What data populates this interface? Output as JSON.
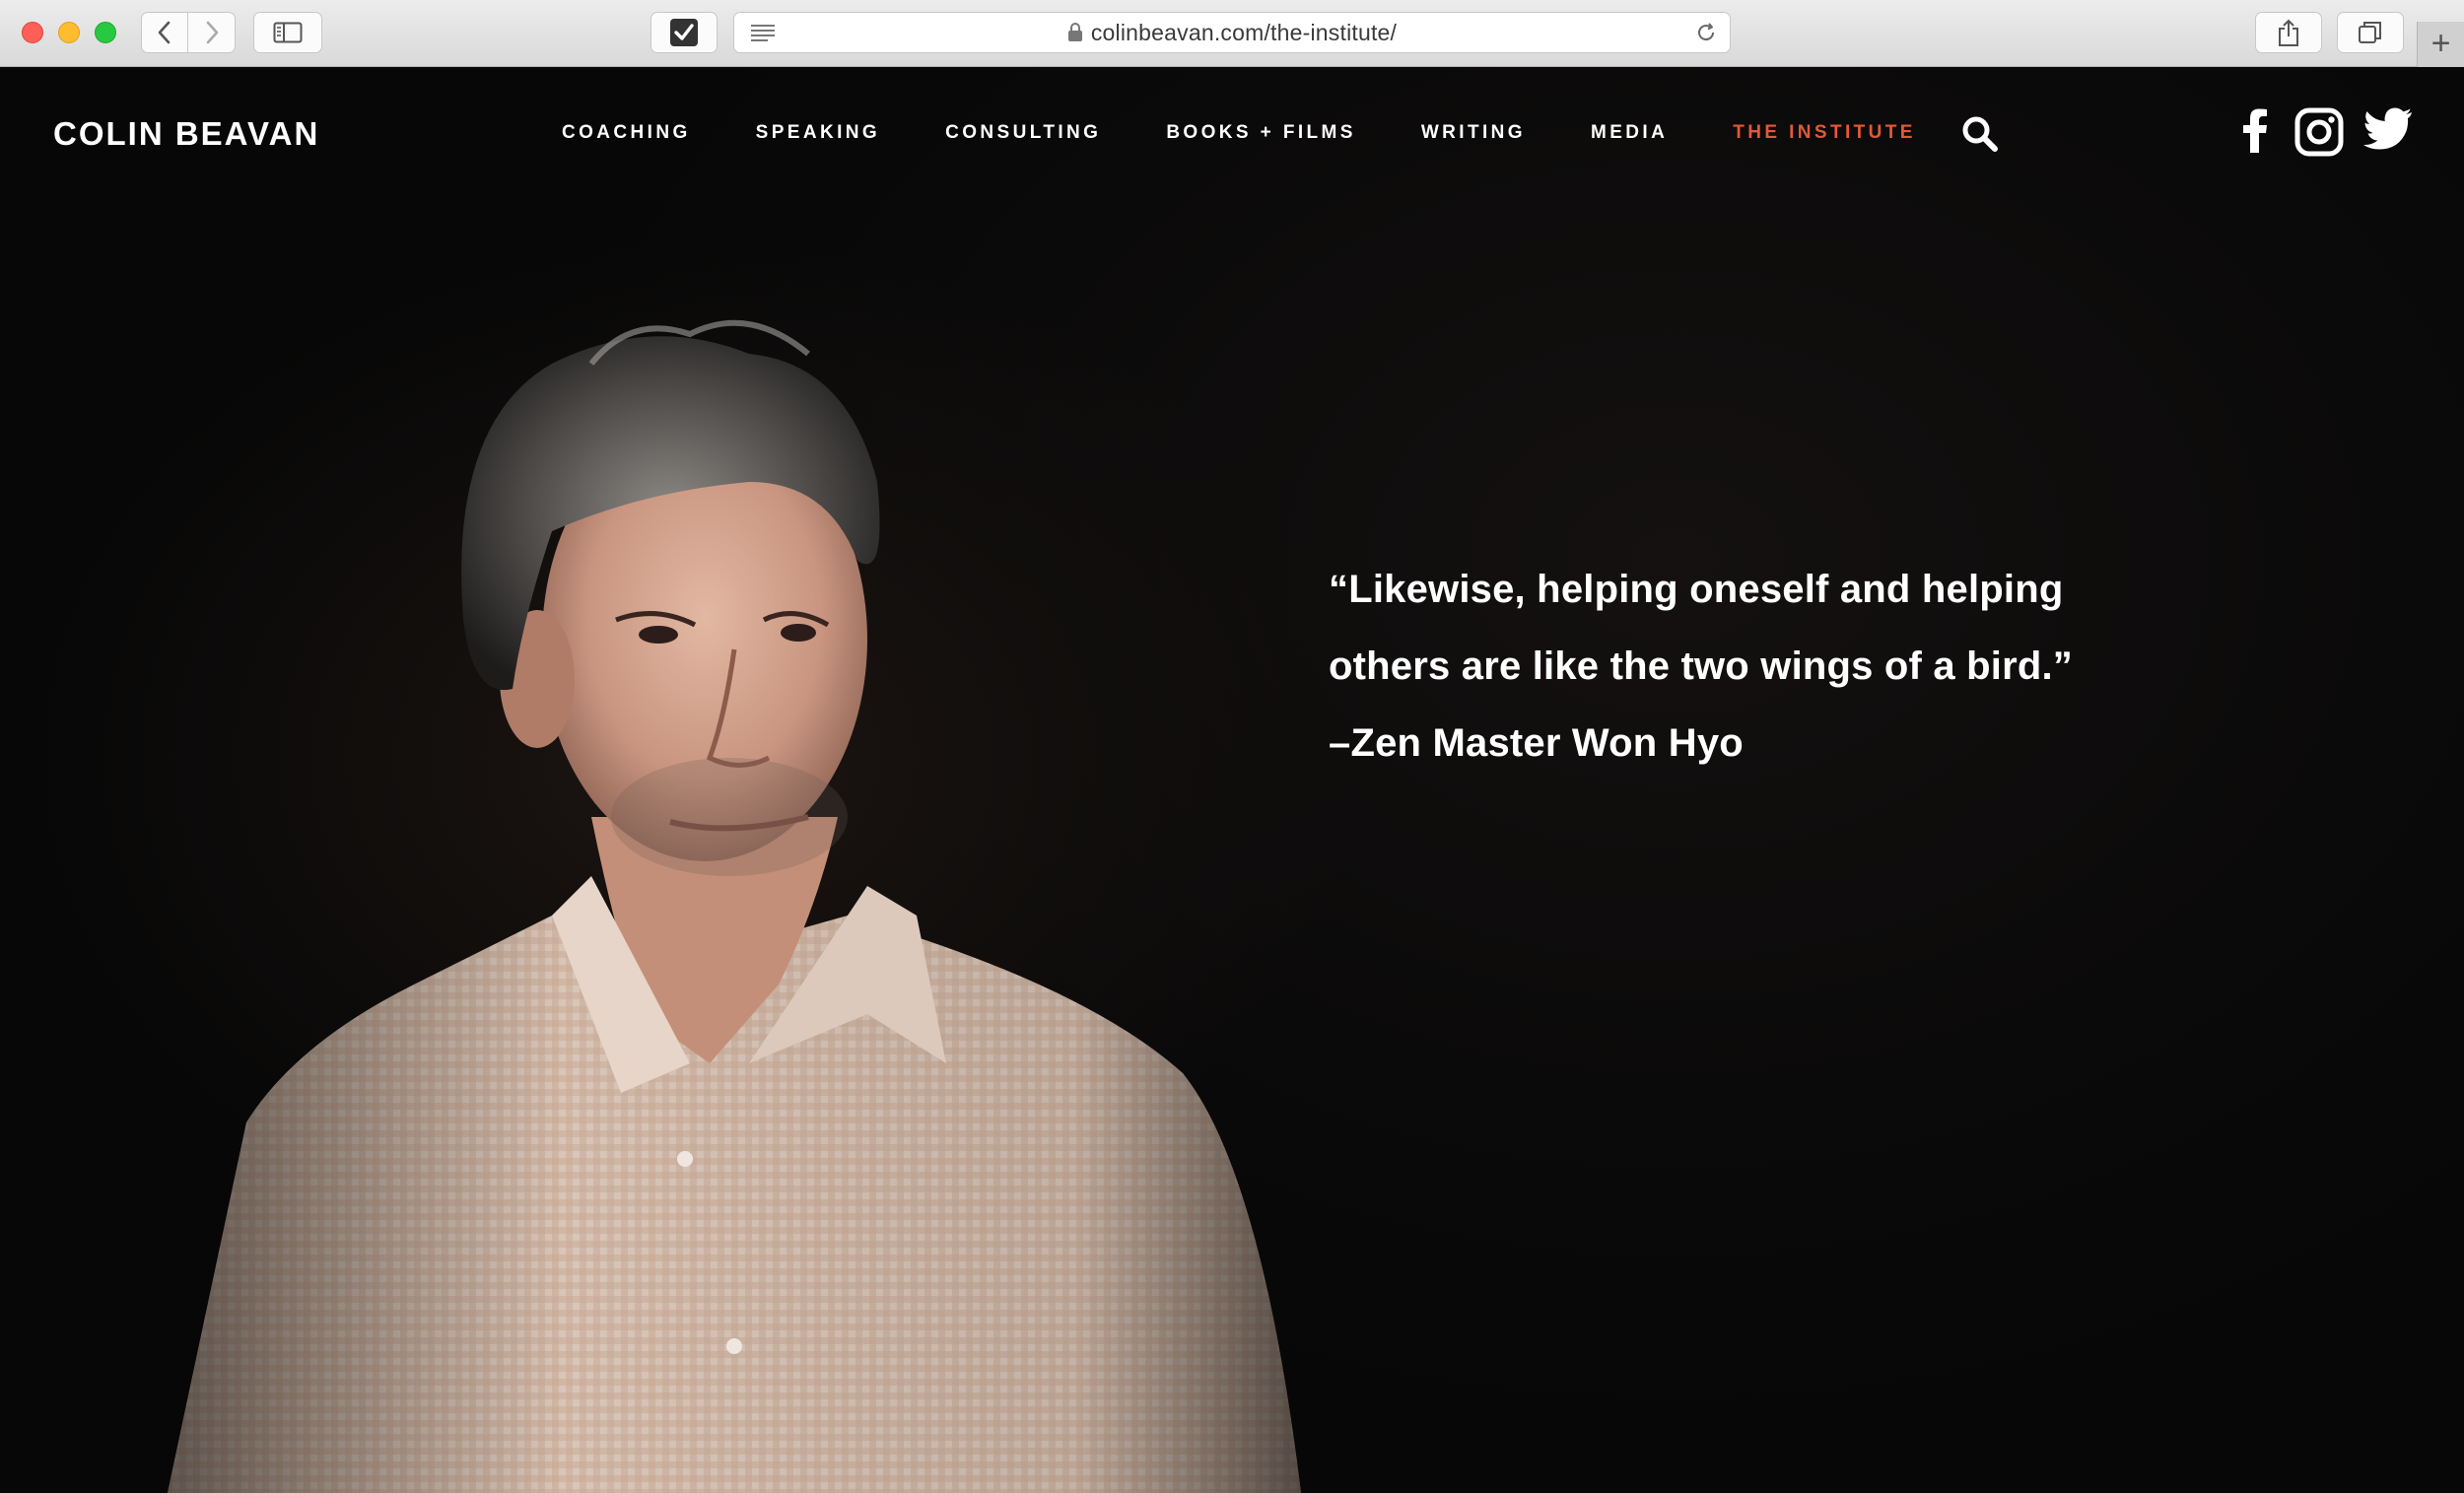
{
  "browser": {
    "url": "colinbeavan.com/the-institute/",
    "new_tab_label": "+"
  },
  "site": {
    "title": "COLIN BEAVAN",
    "nav": [
      {
        "label": "COACHING",
        "active": false
      },
      {
        "label": "SPEAKING",
        "active": false
      },
      {
        "label": "CONSULTING",
        "active": false
      },
      {
        "label": "BOOKS + FILMS",
        "active": false
      },
      {
        "label": "WRITING",
        "active": false
      },
      {
        "label": "MEDIA",
        "active": false
      },
      {
        "label": "THE INSTITUTE",
        "active": true
      }
    ],
    "icons": [
      "search-icon",
      "facebook-icon",
      "instagram-icon",
      "twitter-icon"
    ],
    "accent_color": "#e0593a"
  },
  "hero": {
    "quote_line1": "“Likewise, helping oneself and helping",
    "quote_line2": "others are like the two wings of a bird.”",
    "attribution": "–Zen Master Won Hyo"
  }
}
